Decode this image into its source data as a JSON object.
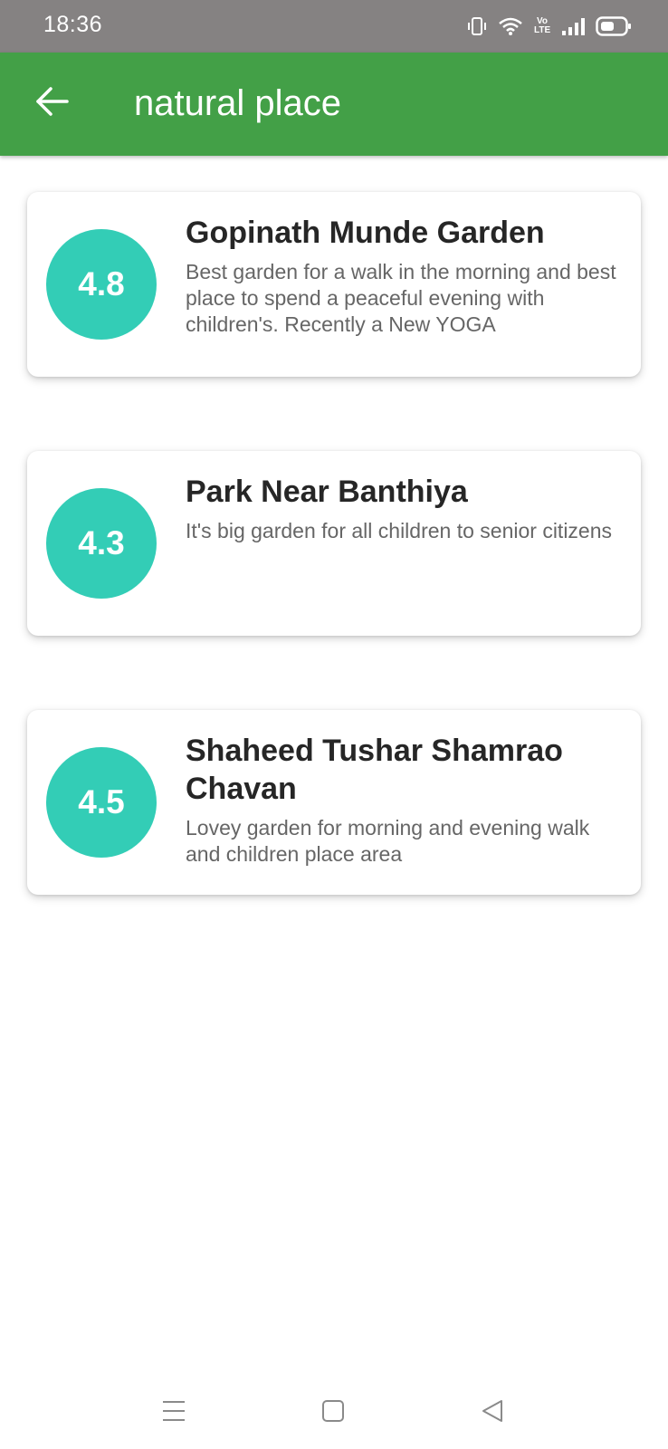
{
  "status_bar": {
    "time": "18:36",
    "icons": [
      "vibrate-icon",
      "wifi-icon",
      "volte-icon",
      "signal-icon",
      "battery-icon"
    ],
    "volte_top": "Vo",
    "volte_bottom": "LTE"
  },
  "app_bar": {
    "title": "natural place",
    "back_icon": "arrow-left-icon",
    "color": "#43a047"
  },
  "places": [
    {
      "rating": "4.8",
      "name": "Gopinath Munde Garden",
      "description": "Best garden for a walk in the morning and best place to spend a peaceful evening with children's. Recently a New YOGA"
    },
    {
      "rating": "4.3",
      "name": "Park Near Banthiya",
      "description": "It's big garden for all children to senior citizens"
    },
    {
      "rating": "4.5",
      "name": "Shaheed Tushar Shamrao Chavan",
      "description": "Lovey garden for morning and evening walk and children place area"
    }
  ],
  "colors": {
    "status_bar": "#858282",
    "rating_circle": "#33cdb6",
    "title_text": "#262626",
    "description_text": "#666666"
  },
  "nav_bar": {
    "icons": [
      "menu-icon",
      "home-square-icon",
      "back-triangle-icon"
    ]
  }
}
